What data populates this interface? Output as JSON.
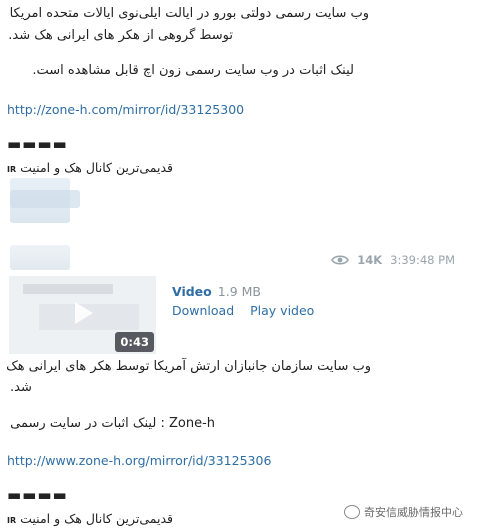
{
  "post1": {
    "line1": "وب سایت رسمی دولتی بورو در ایالت ایلی‌نوی ایالات متحده امریکا",
    "line2": "توسط گروهی از هکر های ایرانی هک شد.",
    "proof": "لینک اثبات در وب سایت رسمی زون اچ قابل مشاهده است.",
    "link": "http://zone-h.com/mirror/id/33125300",
    "separator": "▬▬▬▬",
    "channel": "قدیمی‌ترین کانال هک و امنیت",
    "channel_suffix": "IR"
  },
  "message_meta": {
    "views": "14K",
    "time": "3:39:48 PM",
    "icon": "eye-icon"
  },
  "video": {
    "title": "Video",
    "size": "1.9 MB",
    "download": "Download",
    "play": "Play video",
    "duration": "0:43"
  },
  "post2": {
    "line1": "وب سایت سازمان جانبازان ارتش آمریکا توسط هکر های ایرانی هک",
    "line2": "شد.",
    "proof": "Zone-h : لینک اثبات در سایت رسمی",
    "link": "http://www.zone-h.org/mirror/id/33125306",
    "separator": "▬▬▬▬",
    "channel": "قدیمی‌ترین کانال هک و امنیت",
    "channel_suffix": "IR"
  },
  "watermark": {
    "text": "奇安信威胁情报中心",
    "icon": "wechat-icon"
  }
}
